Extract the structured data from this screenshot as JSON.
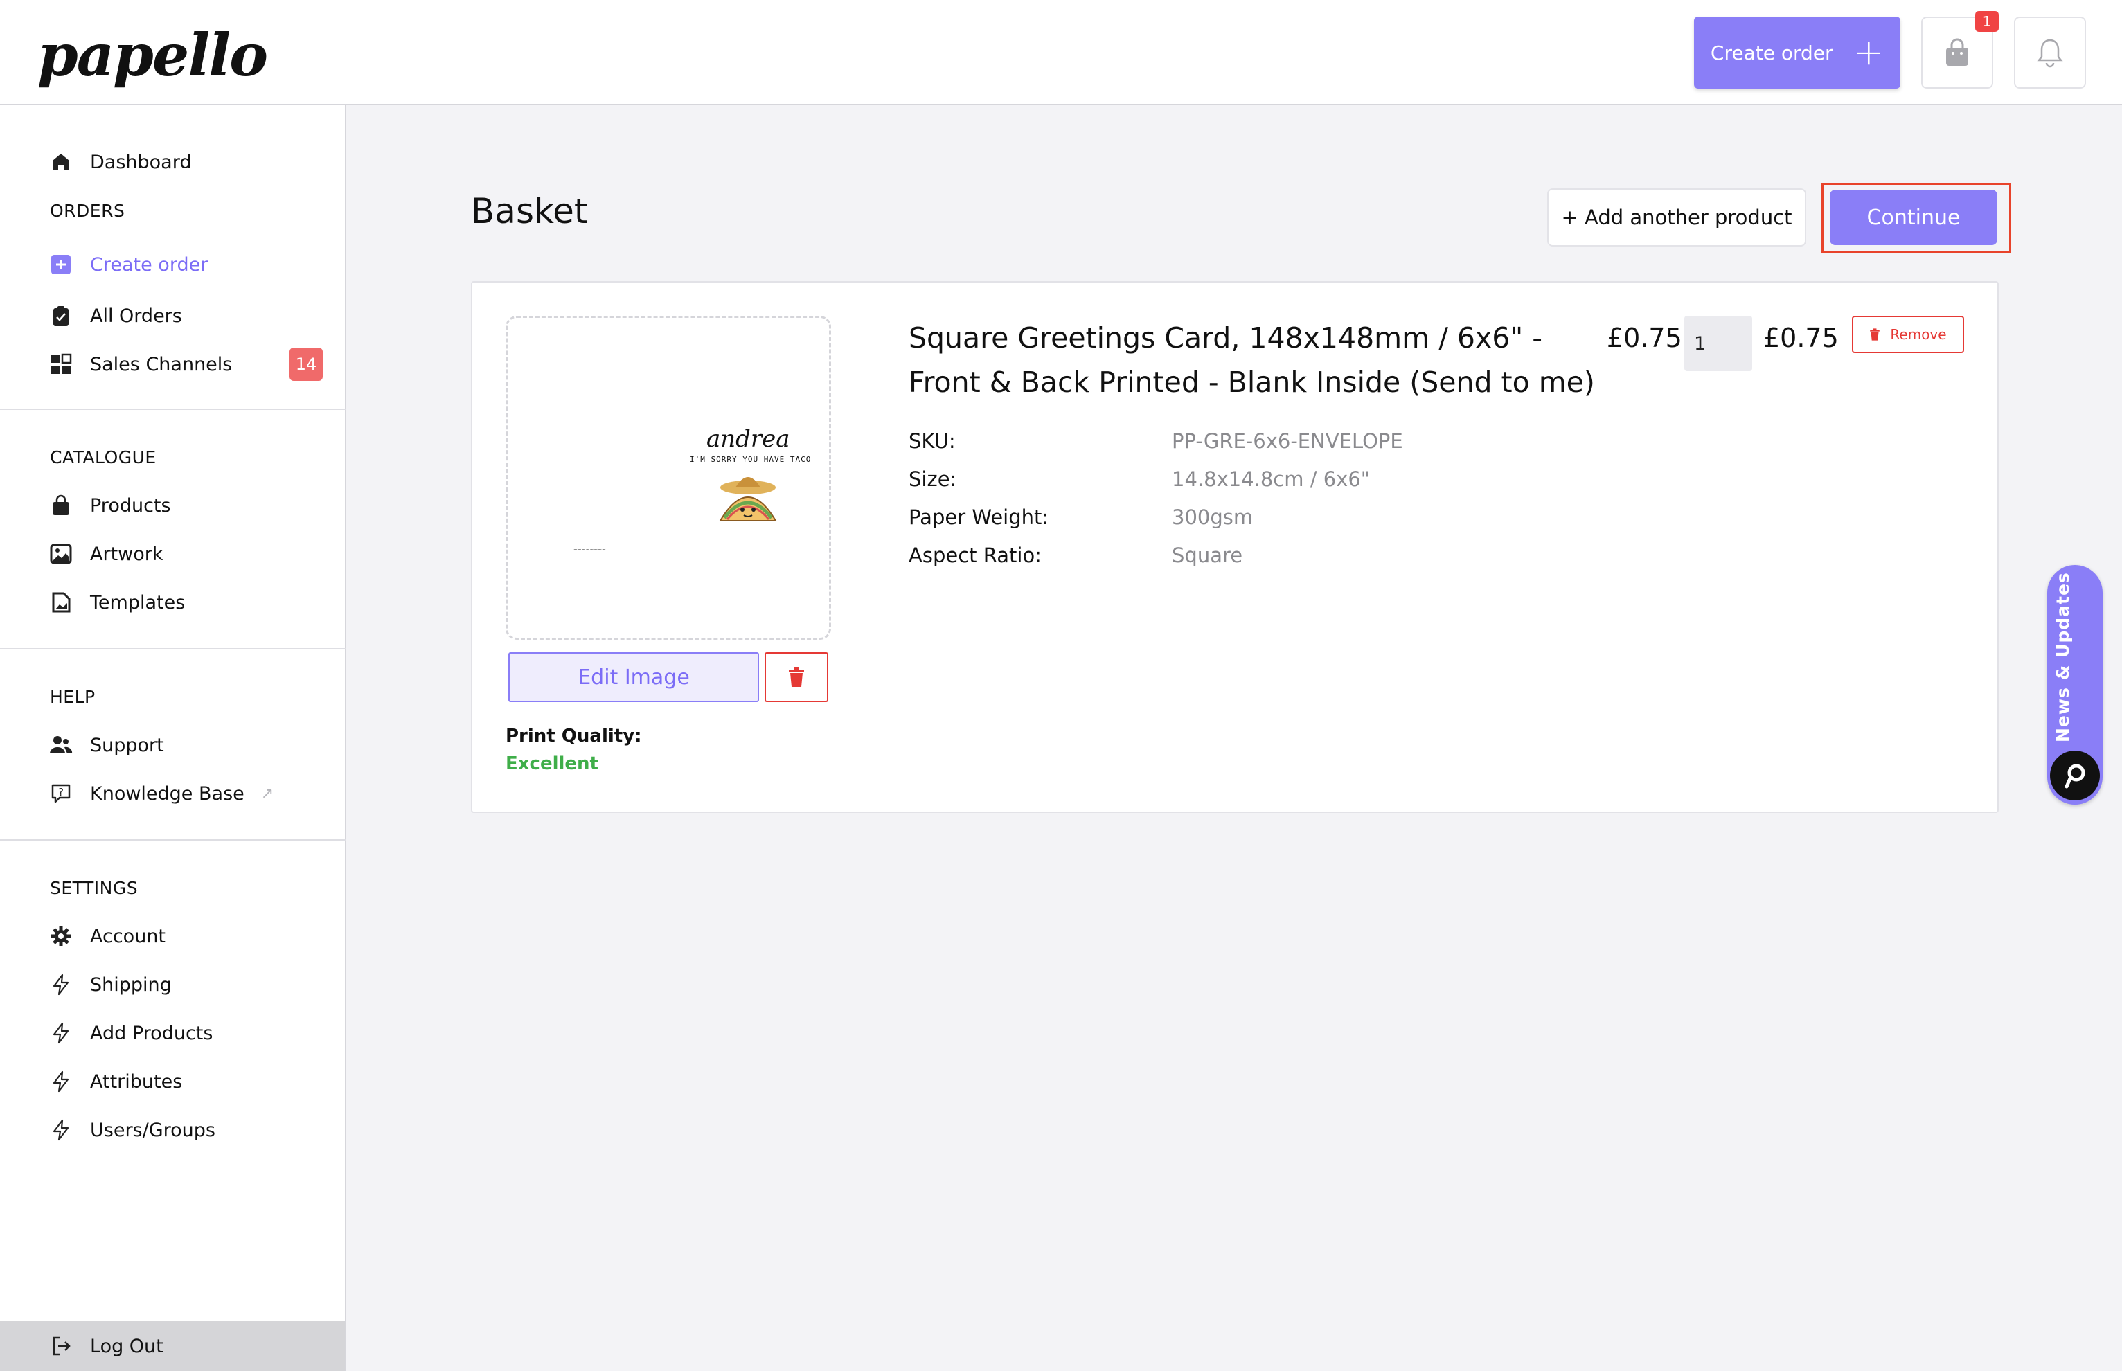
{
  "app": {
    "logo_text": "papello"
  },
  "header": {
    "create_order_label": "Create order",
    "create_order_icon": "plus-icon",
    "basket_icon": "shopping-bag-icon",
    "basket_count": "1",
    "notifications_icon": "bell-icon"
  },
  "sidebar": {
    "dashboard": "Dashboard",
    "sections": {
      "orders": "ORDERS",
      "catalogue": "CATALOGUE",
      "help": "HELP",
      "settings": "SETTINGS"
    },
    "orders_items": [
      {
        "label": "Create order",
        "icon": "plus-square-icon",
        "active": true
      },
      {
        "label": "All Orders",
        "icon": "clipboard-icon"
      },
      {
        "label": "Sales Channels",
        "icon": "grid-icon",
        "badge": "14"
      }
    ],
    "catalogue_items": [
      {
        "label": "Products",
        "icon": "bag-icon"
      },
      {
        "label": "Artwork",
        "icon": "image-icon"
      },
      {
        "label": "Templates",
        "icon": "file-image-icon"
      }
    ],
    "help_items": [
      {
        "label": "Support",
        "icon": "users-icon"
      },
      {
        "label": "Knowledge Base",
        "icon": "help-bubble-icon"
      }
    ],
    "settings_items": [
      {
        "label": "Account",
        "icon": "gear-icon"
      },
      {
        "label": "Shipping",
        "icon": "bolt-icon"
      },
      {
        "label": "Add Products",
        "icon": "bolt-icon"
      },
      {
        "label": "Attributes",
        "icon": "bolt-icon"
      },
      {
        "label": "Users/Groups",
        "icon": "bolt-icon"
      }
    ],
    "logout": "Log Out"
  },
  "main": {
    "title": "Basket",
    "add_product_label": "+ Add another product",
    "continue_label": "Continue",
    "item": {
      "artwork": {
        "name": "andrea",
        "tagline": "I'M SORRY YOU HAVE TACO"
      },
      "edit_image_label": "Edit Image",
      "print_quality_label": "Print Quality:",
      "print_quality_value": "Excellent",
      "title": "Square Greetings Card, 148x148mm / 6x6\" - Front & Back Printed - Blank Inside (Send to me)",
      "unit_price": "£0.75",
      "quantity": "1",
      "total_price": "£0.75",
      "remove_label": "Remove",
      "specs": [
        {
          "label": "SKU:",
          "value": "PP-GRE-6x6-ENVELOPE"
        },
        {
          "label": "Size:",
          "value": "14.8x14.8cm / 6x6\""
        },
        {
          "label": "Paper Weight:",
          "value": "300gsm"
        },
        {
          "label": "Aspect Ratio:",
          "value": "Square"
        }
      ]
    }
  },
  "news_tab": {
    "label": "News & Updates"
  },
  "colors": {
    "accent": "#8a7ef7",
    "danger": "#e53935",
    "success": "#3fae49",
    "badge": "#f06a6a"
  }
}
